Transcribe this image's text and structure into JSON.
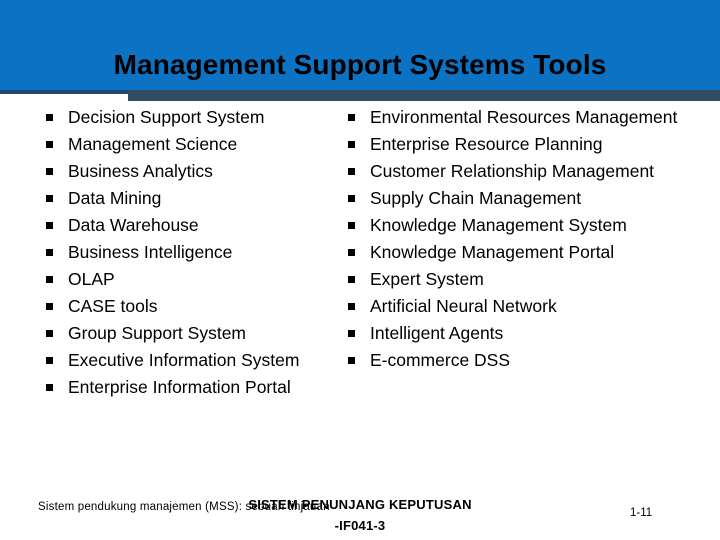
{
  "slide": {
    "title": "Management Support Systems Tools",
    "banner_color": "#0b72c4",
    "banner_rule_color": "#2f4c63",
    "bullet_glyph": "square-bullet"
  },
  "left_column": {
    "items": [
      "Decision Support System",
      "Management Science",
      "Business Analytics",
      "Data Mining",
      "Data Warehouse",
      "Business Intelligence",
      "OLAP",
      "CASE tools",
      "Group Support System",
      "Executive Information System",
      "Enterprise Information Portal"
    ]
  },
  "right_column": {
    "items": [
      "Environmental Resources Management",
      "Enterprise Resource Planning",
      "Customer Relationship Management",
      "Supply Chain Management",
      "Knowledge Management System",
      "Knowledge Management Portal",
      "Expert System",
      "Artificial Neural Network",
      "Intelligent Agents",
      "E-commerce DSS"
    ]
  },
  "footer": {
    "left_note": "Sistem pendukung manajemen (MSS): sebuah tinjauan",
    "center_line1": "SISTEM PENUNJANG KEPUTUSAN",
    "center_line2": "-IF041-3",
    "page_number": "1-11"
  }
}
